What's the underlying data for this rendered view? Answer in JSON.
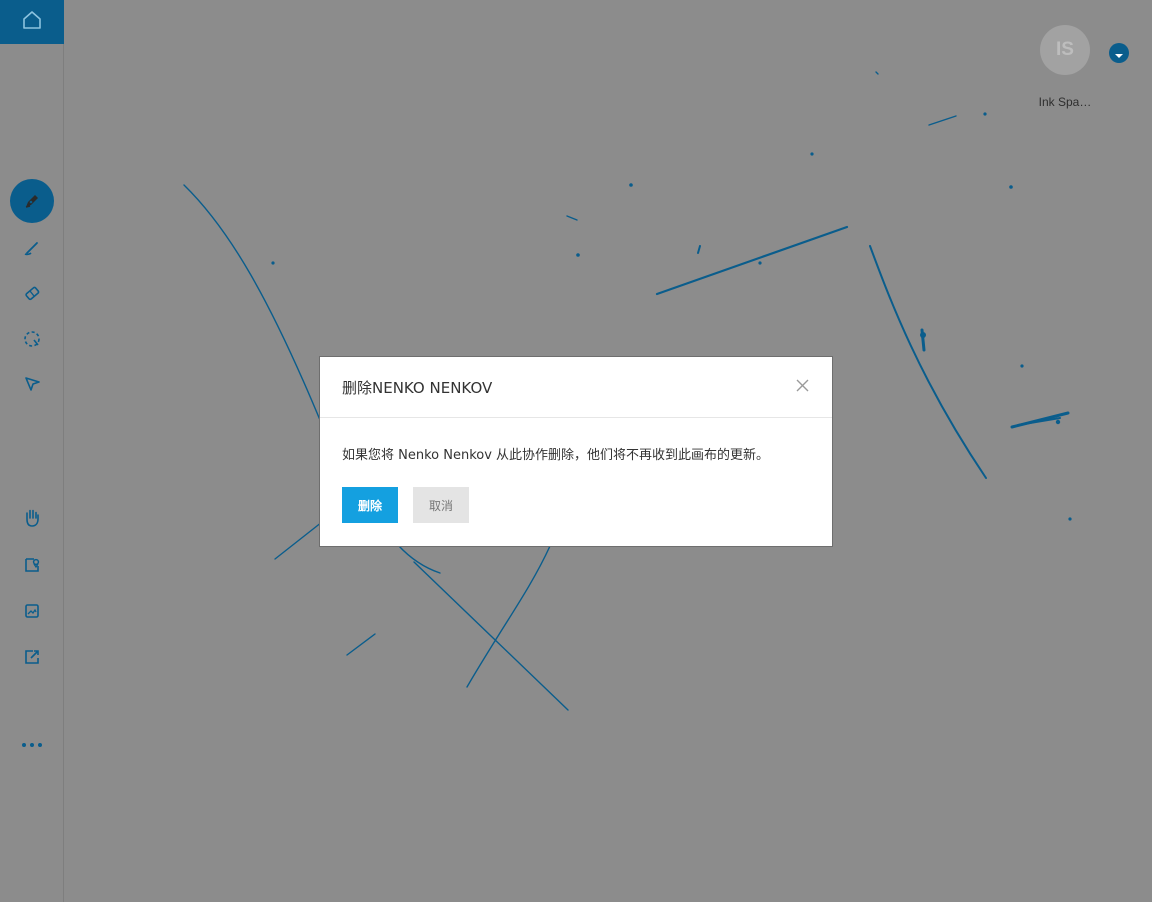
{
  "sidebar": {
    "home_icon": "home-icon",
    "tools": [
      {
        "icon": "pen-icon",
        "active": true
      },
      {
        "icon": "highlighter-icon",
        "active": false
      },
      {
        "icon": "eraser-icon",
        "active": false
      },
      {
        "icon": "lasso-select-icon",
        "active": false
      },
      {
        "icon": "pointer-icon",
        "active": false
      },
      {
        "icon": "hand-icon",
        "active": false
      },
      {
        "icon": "sticker-icon",
        "active": false
      },
      {
        "icon": "image-icon",
        "active": false
      },
      {
        "icon": "share-icon",
        "active": false
      },
      {
        "icon": "more-icon",
        "active": false
      }
    ]
  },
  "user": {
    "initials": "IS",
    "name": "Ink Spa…"
  },
  "dialog": {
    "title": "删除NENKO NENKOV",
    "message": "如果您将 Nenko Nenkov 从此协作删除，他们将不再收到此画布的更新。",
    "delete_label": "删除",
    "cancel_label": "取消"
  },
  "colors": {
    "accent": "#0a5d8c",
    "ink": "#0a5d8c",
    "primary_button": "#14a0e0",
    "overlay": "#8c8c8c"
  }
}
